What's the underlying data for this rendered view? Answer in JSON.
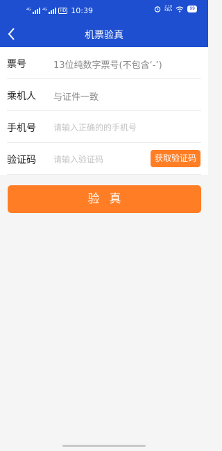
{
  "status_bar": {
    "time": "10:39",
    "signal1_label": "4G",
    "signal2_label": "4G",
    "hd_label": "HD",
    "net_speed_value": "2.10",
    "net_speed_unit": "KB/s",
    "battery": "99"
  },
  "header": {
    "title": "机票验真"
  },
  "form": {
    "ticket_no": {
      "label": "票号",
      "value": "13位纯数字票号(不包含‘-’)"
    },
    "passenger": {
      "label": "乘机人",
      "value": "与证件一致"
    },
    "phone": {
      "label": "手机号",
      "placeholder": "请输入正确的的手机号"
    },
    "code": {
      "label": "验证码",
      "placeholder": "请输入验证码",
      "button": "获取验证码"
    }
  },
  "verify_button": "验真",
  "colors": {
    "primary": "#1d4fd0",
    "accent": "#ff7e25"
  }
}
